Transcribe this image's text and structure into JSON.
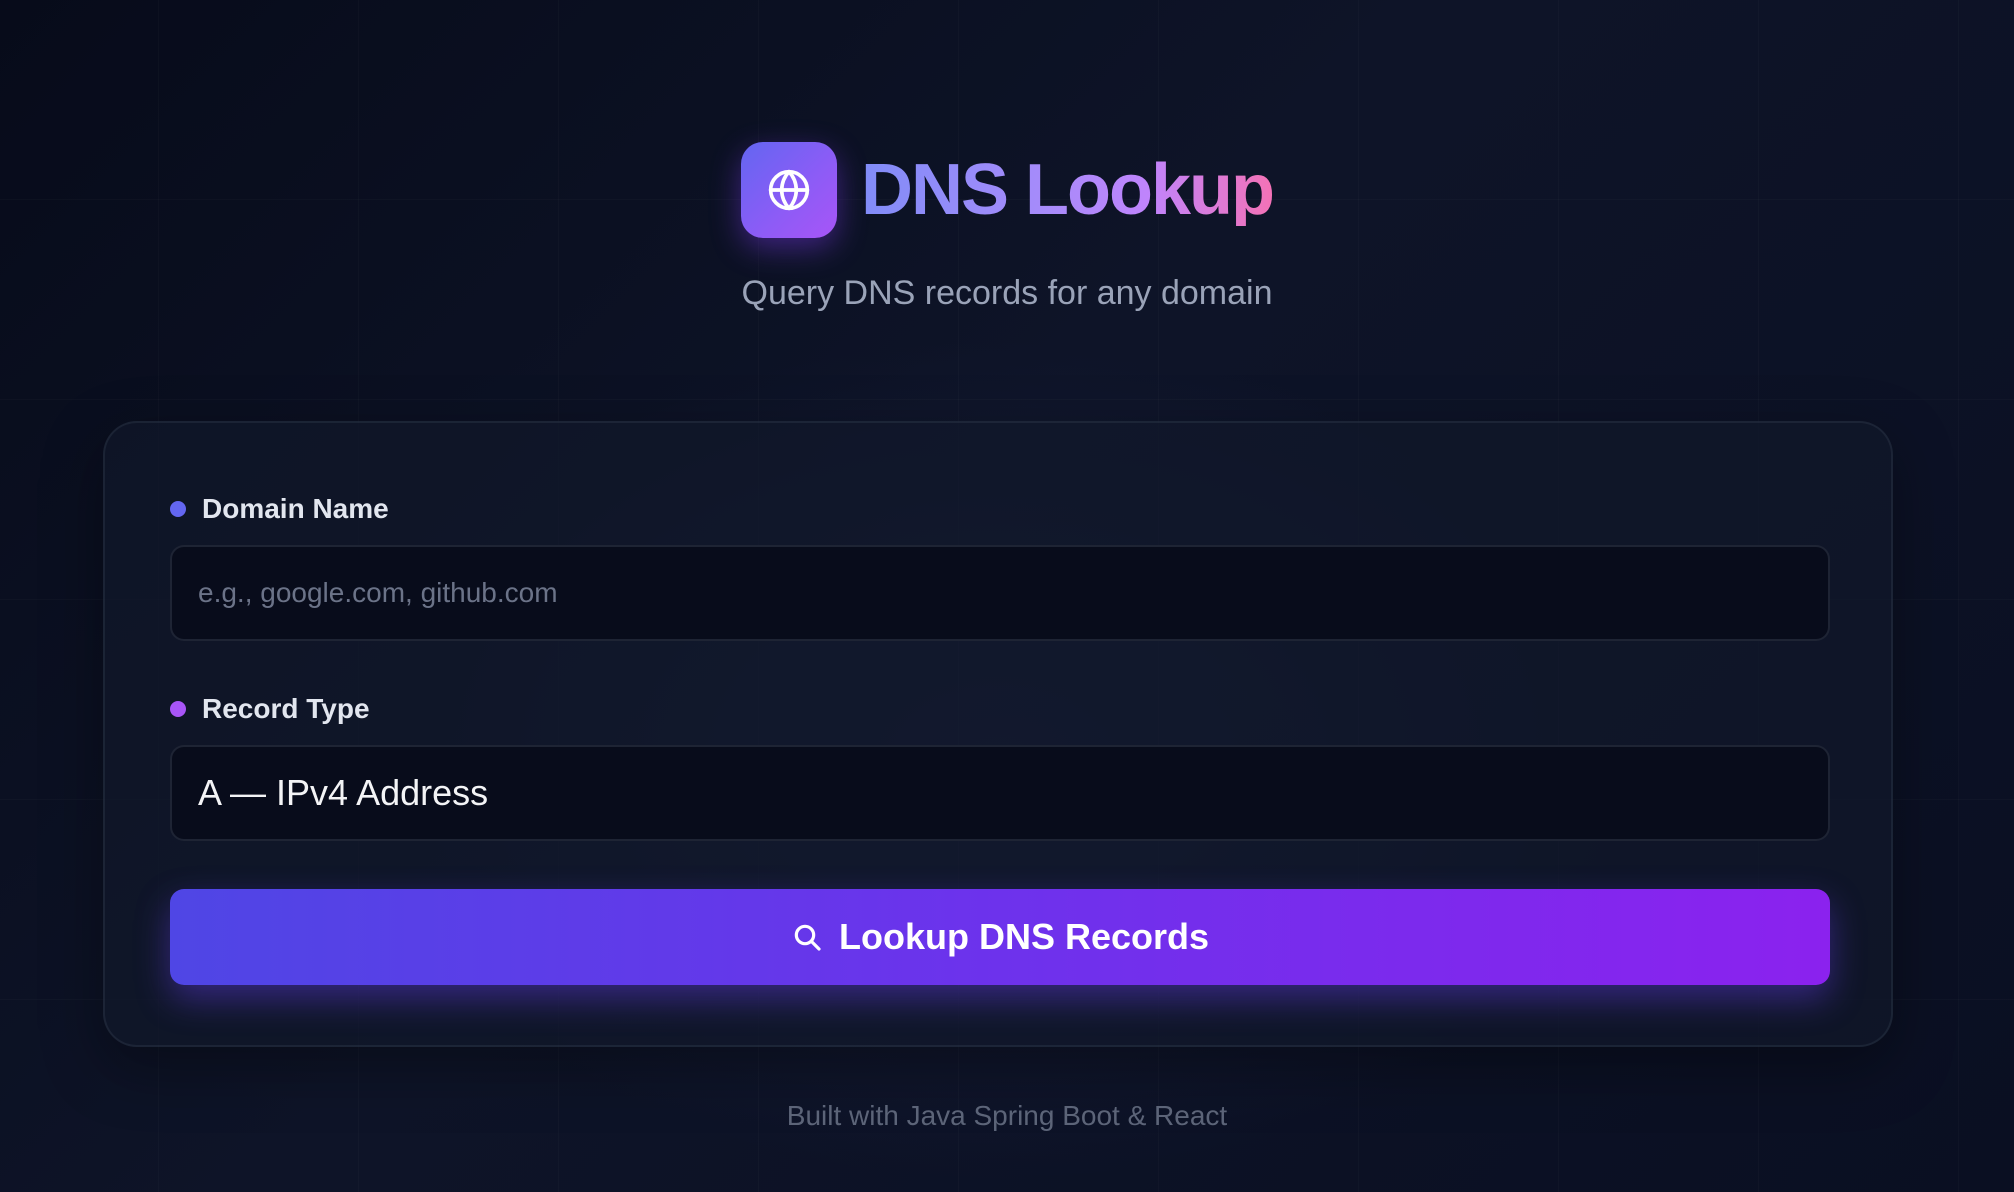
{
  "header": {
    "title": "DNS Lookup",
    "subtitle": "Query DNS records for any domain",
    "logo_icon": "globe-icon"
  },
  "form": {
    "domain": {
      "label": "Domain Name",
      "placeholder": "e.g., google.com, github.com",
      "value": "",
      "dot_color": "#6366f1"
    },
    "record_type": {
      "label": "Record Type",
      "selected": "A — IPv4 Address",
      "dot_color": "#a855f7"
    },
    "submit": {
      "label": "Lookup DNS Records",
      "icon": "search-icon"
    }
  },
  "footer": {
    "text": "Built with Java Spring Boot & React"
  },
  "colors": {
    "background": "#0b1022",
    "accent_start": "#4f46e5",
    "accent_end": "#8b22ee",
    "title_gradient_end": "#f472b6"
  }
}
